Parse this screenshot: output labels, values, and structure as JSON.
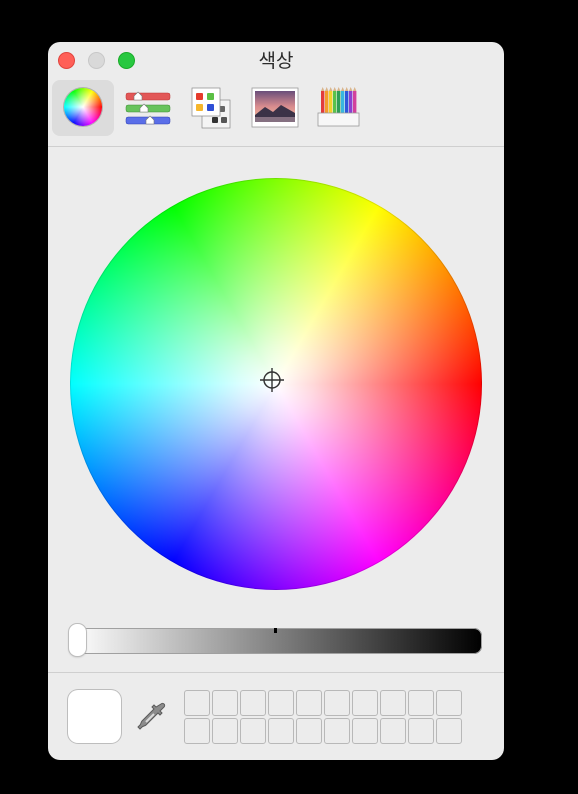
{
  "window": {
    "title": "색상"
  },
  "toolbar": {
    "tabs": [
      {
        "name": "color-wheel",
        "selected": true
      },
      {
        "name": "color-sliders",
        "selected": false
      },
      {
        "name": "color-palettes",
        "selected": false
      },
      {
        "name": "image-palettes",
        "selected": false
      },
      {
        "name": "pencils",
        "selected": false
      }
    ]
  },
  "slider": {
    "brightness_percent": 100
  },
  "current_color": "#ffffff",
  "colors": {
    "traffic_close": "#ff5f57",
    "traffic_min": "#d9d9d9",
    "traffic_zoom": "#28c840",
    "window_bg": "#ececec"
  },
  "swatch_slots": {
    "rows": 2,
    "cols": 10
  }
}
